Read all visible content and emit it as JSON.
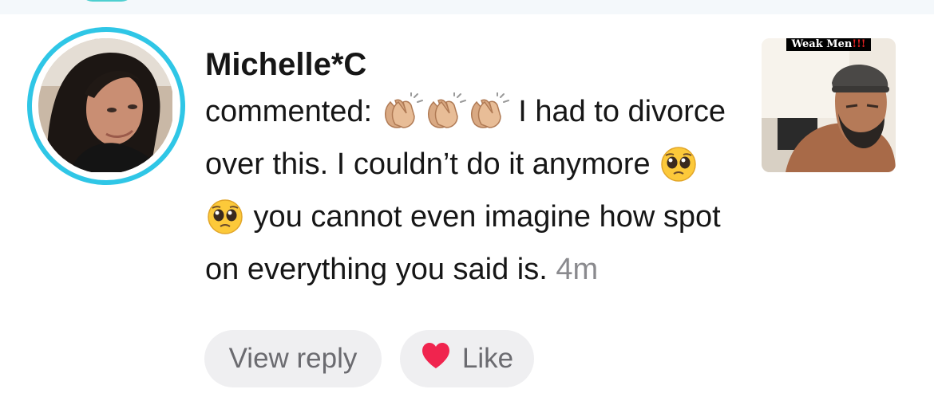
{
  "comment": {
    "username": "Michelle*C",
    "prefix": "commented:",
    "emoji_clap": "clapping-hands",
    "text_part1": " I had to divorce over this. I couldn’t do it anymore ",
    "emoji_pleading": "pleading-face",
    "text_part2": " you cannot even imagine how spot on everything you said is.",
    "timestamp": "4m"
  },
  "thumbnail": {
    "caption": "Weak Men",
    "caption_suffix": "!!!"
  },
  "actions": {
    "reply_label": "View reply",
    "like_label": "Like"
  },
  "colors": {
    "avatar_ring": "#2fc6e6",
    "like_heart": "#f0244e",
    "button_bg": "#efeff1",
    "timestamp": "#8a8a8e"
  }
}
